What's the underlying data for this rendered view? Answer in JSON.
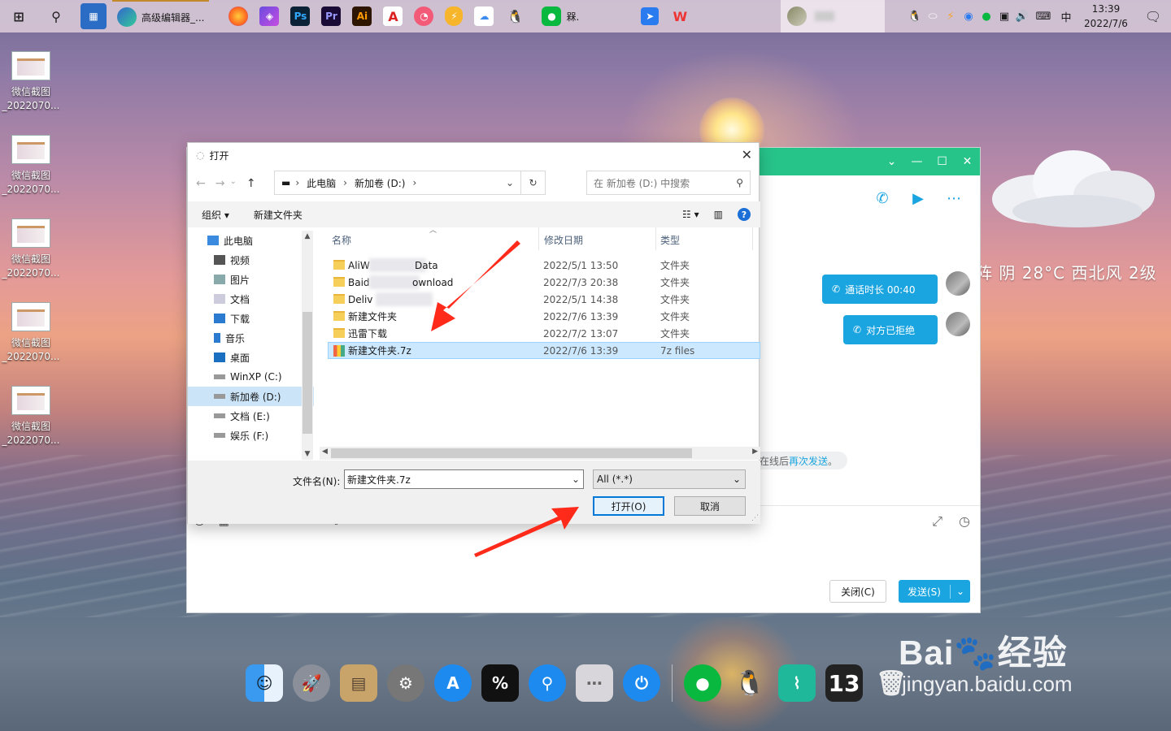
{
  "taskbar": {
    "editor_label": "高级编辑器_...",
    "wechat_label": "槑.",
    "tray_ime": "中",
    "clock_time": "13:39",
    "clock_date": "2022/7/6"
  },
  "desktop": {
    "items": [
      {
        "line1": "微信截图",
        "line2": "_2022070..."
      },
      {
        "line1": "微信截图",
        "line2": "_2022070..."
      },
      {
        "line1": "微信截图",
        "line2": "_2022070..."
      },
      {
        "line1": "微信截图",
        "line2": "_2022070..."
      },
      {
        "line1": "微信截图",
        "line2": "_2022070..."
      }
    ]
  },
  "weather": "阵  阴  28°C  西北风  2级",
  "chat": {
    "bubble1": "通话时长 00:40",
    "bubble2": "对方已拒绝",
    "notice_prefix": "在线后",
    "notice_link": "再次发送",
    "notice_suffix": "。",
    "close_label": "关闭(C)",
    "send_label": "发送(S)"
  },
  "dialog": {
    "title": "打开",
    "address": {
      "segment1": "此电脑",
      "segment2": "新加卷 (D:)"
    },
    "search_placeholder": "在 新加卷 (D:) 中搜索",
    "organize_label": "组织",
    "new_folder_label": "新建文件夹",
    "tree": [
      {
        "label": "此电脑",
        "icon": "computer-icon"
      },
      {
        "label": "视频",
        "icon": "video-icon"
      },
      {
        "label": "图片",
        "icon": "pictures-icon"
      },
      {
        "label": "文档",
        "icon": "documents-icon"
      },
      {
        "label": "下载",
        "icon": "download-icon"
      },
      {
        "label": "音乐",
        "icon": "music-icon"
      },
      {
        "label": "桌面",
        "icon": "desktop-icon"
      },
      {
        "label": "WinXP (C:)",
        "icon": "drive-icon"
      },
      {
        "label": "新加卷 (D:)",
        "icon": "drive-icon"
      },
      {
        "label": "文档 (E:)",
        "icon": "drive-icon"
      },
      {
        "label": "娱乐 (F:)",
        "icon": "drive-icon"
      }
    ],
    "columns": {
      "name": "名称",
      "date": "修改日期",
      "type": "类型"
    },
    "files": [
      {
        "name": "AliW",
        "name_tail": "Data",
        "date": "2022/5/1 13:50",
        "type": "文件夹"
      },
      {
        "name": "Baid",
        "name_tail": "ownload",
        "date": "2022/7/3 20:38",
        "type": "文件夹"
      },
      {
        "name": "Deliv",
        "name_tail": "",
        "date": "2022/5/1 14:38",
        "type": "文件夹"
      },
      {
        "name": "新建文件夹",
        "name_tail": "",
        "date": "2022/7/6 13:39",
        "type": "文件夹"
      },
      {
        "name": "迅雷下载",
        "name_tail": "",
        "date": "2022/7/2 13:07",
        "type": "文件夹"
      },
      {
        "name": "新建文件夹.7z",
        "name_tail": "",
        "date": "2022/7/6 13:39",
        "type": "7z files"
      }
    ],
    "filename_label": "文件名(N):",
    "filename_value": "新建文件夹.7z",
    "filetype_value": "All (*.*)",
    "open_label": "打开(O)",
    "cancel_label": "取消"
  },
  "dock": {
    "badge_13": "13"
  },
  "watermark": {
    "big": "Bai",
    "big2": "经验",
    "small": "jingyan.baidu.com"
  },
  "colors": {
    "accent": "#1ba5e0",
    "chat_header": "#27c48a",
    "selection": "#cce8ff",
    "arrow": "#ff2a1a"
  }
}
